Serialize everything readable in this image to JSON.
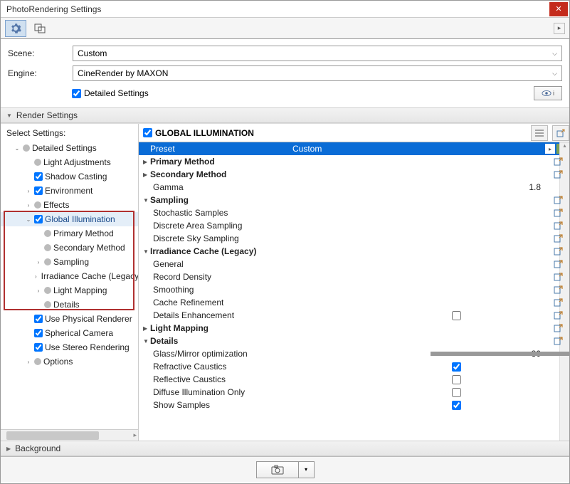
{
  "window": {
    "title": "PhotoRendering Settings"
  },
  "form": {
    "scene_label": "Scene:",
    "scene_value": "Custom",
    "engine_label": "Engine:",
    "engine_value": "CineRender by MAXON",
    "detailed_label": "Detailed Settings"
  },
  "sections": {
    "render_settings": "Render Settings",
    "select_settings": "Select Settings:",
    "background": "Background"
  },
  "tree": [
    {
      "level": 1,
      "exp": "down",
      "type": "bullet",
      "label": "Detailed Settings"
    },
    {
      "level": 2,
      "exp": "",
      "type": "bullet",
      "label": "Light Adjustments"
    },
    {
      "level": 2,
      "exp": "",
      "type": "check",
      "checked": true,
      "label": "Shadow Casting"
    },
    {
      "level": 2,
      "exp": "right",
      "type": "check",
      "checked": true,
      "label": "Environment"
    },
    {
      "level": 2,
      "exp": "right",
      "type": "bullet",
      "label": "Effects"
    },
    {
      "level": 2,
      "exp": "down",
      "type": "check",
      "checked": true,
      "label": "Global Illumination",
      "selected": true
    },
    {
      "level": 3,
      "exp": "",
      "type": "bullet",
      "label": "Primary Method"
    },
    {
      "level": 3,
      "exp": "",
      "type": "bullet",
      "label": "Secondary Method"
    },
    {
      "level": 3,
      "exp": "right",
      "type": "bullet",
      "label": "Sampling"
    },
    {
      "level": 3,
      "exp": "right",
      "type": "bullet",
      "label": "Irradiance Cache (Legacy)"
    },
    {
      "level": 3,
      "exp": "right",
      "type": "bullet",
      "label": "Light Mapping"
    },
    {
      "level": 3,
      "exp": "",
      "type": "bullet",
      "label": "Details"
    },
    {
      "level": 2,
      "exp": "",
      "type": "check",
      "checked": true,
      "label": "Use Physical Renderer"
    },
    {
      "level": 2,
      "exp": "",
      "type": "check",
      "checked": true,
      "label": "Spherical Camera"
    },
    {
      "level": 2,
      "exp": "",
      "type": "check",
      "checked": true,
      "label": "Use Stereo Rendering"
    },
    {
      "level": 2,
      "exp": "right",
      "type": "bullet",
      "label": "Options"
    }
  ],
  "gi_header": "GLOBAL ILLUMINATION",
  "preset": {
    "key": "Preset",
    "value": "Custom"
  },
  "props": [
    {
      "kind": "group",
      "exp": "right",
      "label": "Primary Method",
      "act": true
    },
    {
      "kind": "group",
      "exp": "right",
      "label": "Secondary Method",
      "act": true
    },
    {
      "kind": "item",
      "indent": 1,
      "label": "Gamma",
      "value": "1.8"
    },
    {
      "kind": "group",
      "exp": "down",
      "label": "Sampling",
      "act": true
    },
    {
      "kind": "item",
      "indent": 1,
      "label": "Stochastic Samples",
      "act": true
    },
    {
      "kind": "item",
      "indent": 1,
      "label": "Discrete Area Sampling",
      "act": true
    },
    {
      "kind": "item",
      "indent": 1,
      "label": "Discrete Sky Sampling",
      "act": true
    },
    {
      "kind": "group",
      "exp": "down",
      "label": "Irradiance Cache (Legacy)",
      "act": true
    },
    {
      "kind": "item",
      "indent": 1,
      "label": "General",
      "act": true
    },
    {
      "kind": "item",
      "indent": 1,
      "label": "Record Density",
      "act": true
    },
    {
      "kind": "item",
      "indent": 1,
      "label": "Smoothing",
      "act": true
    },
    {
      "kind": "item",
      "indent": 1,
      "label": "Cache Refinement",
      "act": true
    },
    {
      "kind": "item",
      "indent": 1,
      "label": "Details Enhancement",
      "cb": false,
      "act": true
    },
    {
      "kind": "group",
      "exp": "right",
      "label": "Light Mapping",
      "act": true
    },
    {
      "kind": "group",
      "exp": "down",
      "label": "Details",
      "act": true
    },
    {
      "kind": "item",
      "indent": 1,
      "label": "Glass/Mirror optimization",
      "slider": 80,
      "value": "80"
    },
    {
      "kind": "item",
      "indent": 1,
      "label": "Refractive Caustics",
      "cb": true
    },
    {
      "kind": "item",
      "indent": 1,
      "label": "Reflective Caustics",
      "cb": false
    },
    {
      "kind": "item",
      "indent": 1,
      "label": "Diffuse Illumination Only",
      "cb": false
    },
    {
      "kind": "item",
      "indent": 1,
      "label": "Show Samples",
      "cb": true
    }
  ]
}
